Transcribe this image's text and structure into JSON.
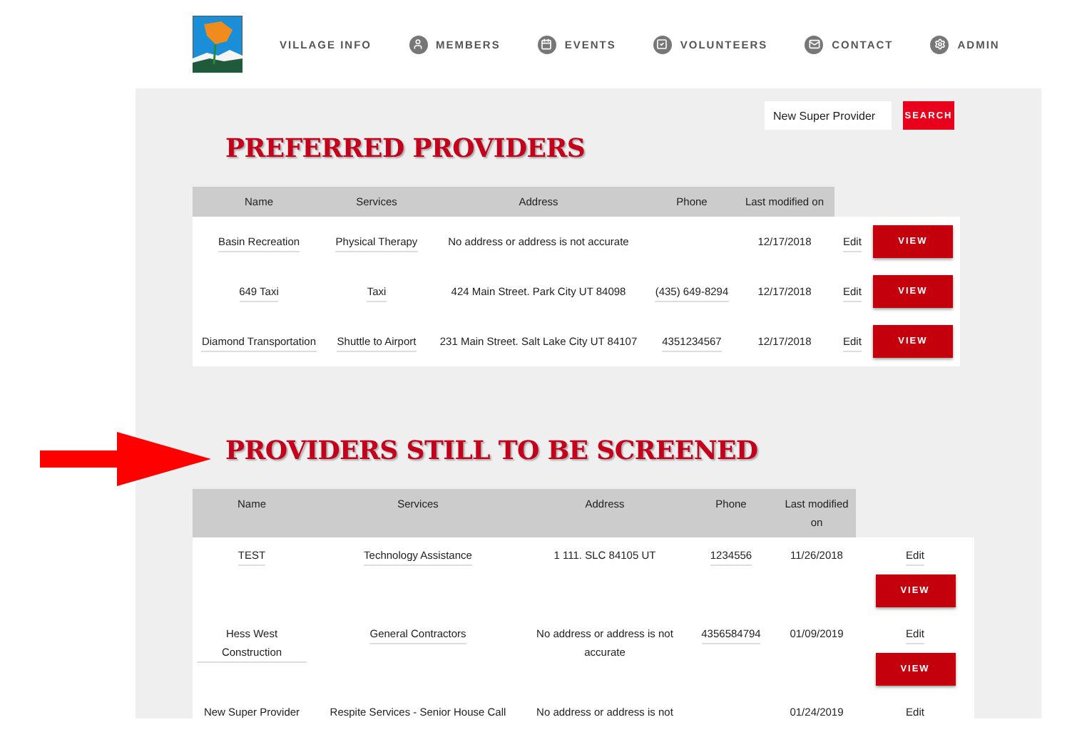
{
  "nav": [
    {
      "label": "VILLAGE INFO",
      "kind": "plain"
    },
    {
      "label": "MEMBERS",
      "kind": "user"
    },
    {
      "label": "EVENTS",
      "kind": "calendar"
    },
    {
      "label": "VOLUNTEERS",
      "kind": "check"
    },
    {
      "label": "CONTACT",
      "kind": "mail"
    },
    {
      "label": "ADMIN",
      "kind": "gear"
    }
  ],
  "search": {
    "value": "New Super Provider",
    "button": "SEARCH"
  },
  "sections": [
    {
      "title": "PREFERRED PROVIDERS",
      "arrow": false,
      "columns": [
        "Name",
        "Services",
        "Address",
        "Phone",
        "Last modified on"
      ],
      "rows": [
        {
          "name": "Basin Recreation",
          "services": "Physical Therapy",
          "address": "No address or address is not accurate",
          "date": "12/17/2018",
          "edit": "Edit",
          "view": "VIEW"
        },
        {
          "name": "649 Taxi",
          "services": "Taxi",
          "address": "424 Main Street. Park City UT 84098",
          "phone": "(435) 649-8294",
          "date": "12/17/2018",
          "edit": "Edit",
          "view": "VIEW"
        },
        {
          "name": "Diamond Transportation",
          "services": "Shuttle to Airport",
          "address": "231 Main Street. Salt Lake City UT 84107",
          "phone": "4351234567",
          "date": "12/17/2018",
          "edit": "Edit",
          "view": "VIEW"
        }
      ]
    },
    {
      "title": "PROVIDERS STILL TO BE SCREENED",
      "arrow": true,
      "columns": [
        "Name",
        "Services",
        "Address",
        "Phone",
        "Last modified on"
      ],
      "rows": [
        {
          "name": "TEST",
          "services": "Technology Assistance",
          "address": "1 111. SLC 84105 UT",
          "phone": "1234556",
          "date": "11/26/2018",
          "edit": "Edit",
          "view": "VIEW"
        },
        {
          "name": "Hess West Construction",
          "services": "General Contractors",
          "address": "No address or address is not accurate",
          "phone": "4356584794",
          "date": "01/09/2019",
          "edit": "Edit",
          "view": "VIEW"
        },
        {
          "name": "New Super Provider",
          "services": "Respite Services - Senior House Call",
          "address": "No address or address is not",
          "date": "01/24/2019",
          "edit": "Edit"
        }
      ]
    }
  ]
}
